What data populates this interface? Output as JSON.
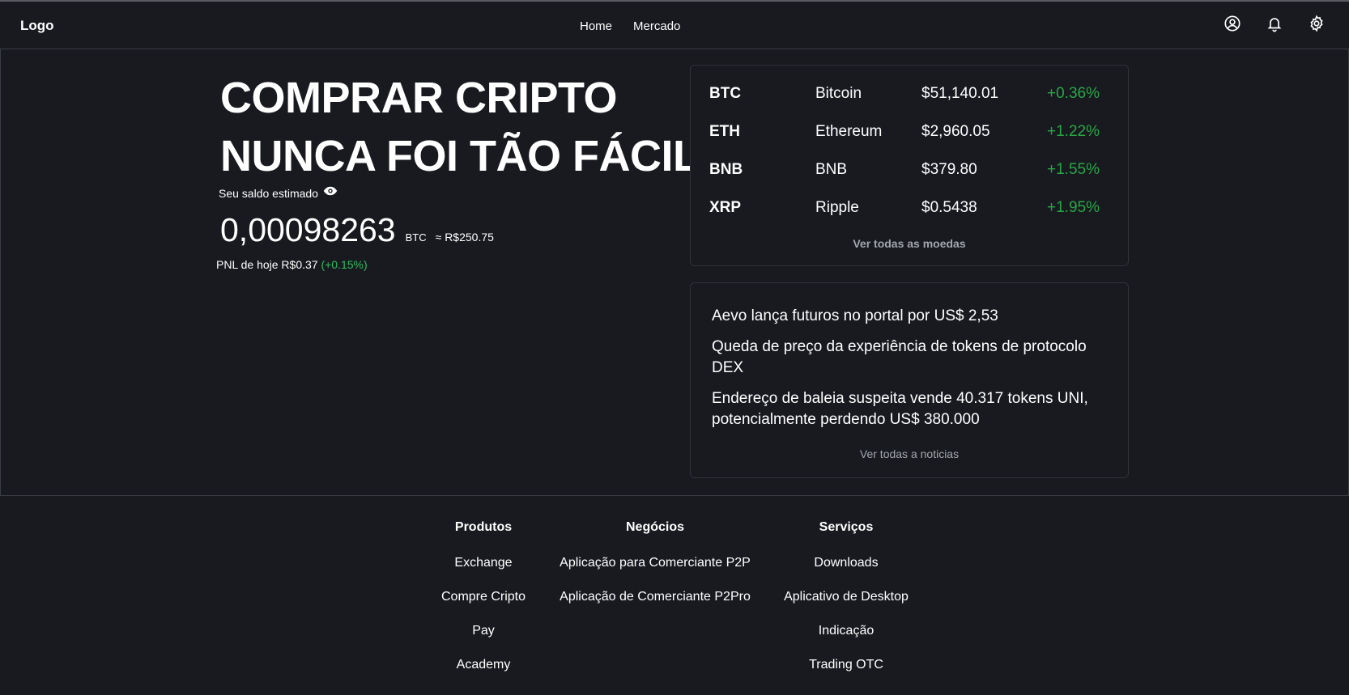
{
  "header": {
    "logo": "Logo",
    "nav": [
      "Home",
      "Mercado"
    ],
    "icons": [
      "user-icon",
      "bell-icon",
      "settings-icon"
    ]
  },
  "hero": {
    "title_line1": "COMPRAR CRIPTO",
    "title_line2": "NUNCA FOI TÃO FÁCIL",
    "balance_label": "Seu saldo estimado",
    "balance_value": "0,00098263",
    "balance_unit": "BTC",
    "balance_fiat": "≈ R$250.75",
    "pnl_label": "PNL de hoje R$0.37",
    "pnl_change": "(+0.15%)"
  },
  "coins": {
    "items": [
      {
        "symbol": "BTC",
        "name": "Bitcoin",
        "price": "$51,140.01",
        "change": "+0.36%"
      },
      {
        "symbol": "ETH",
        "name": "Ethereum",
        "price": "$2,960.05",
        "change": "+1.22%"
      },
      {
        "symbol": "BNB",
        "name": "BNB",
        "price": "$379.80",
        "change": "+1.55%"
      },
      {
        "symbol": "XRP",
        "name": "Ripple",
        "price": "$0.5438",
        "change": "+1.95%"
      }
    ],
    "more_label": "Ver todas as moedas"
  },
  "news": {
    "items": [
      "Aevo lança futuros no portal por US$ 2,53",
      "Queda de preço da experiência de tokens de protocolo DEX",
      "Endereço de baleia suspeita vende 40.317 tokens UNI, potencialmente perdendo US$ 380.000"
    ],
    "more_label": "Ver todas a noticias"
  },
  "footer": {
    "produtos": {
      "title": "Produtos",
      "links": [
        "Exchange",
        "Compre Cripto",
        "Pay",
        "Academy"
      ]
    },
    "negocios": {
      "title": "Negócios",
      "links": [
        "Aplicação para Comerciante P2P",
        "Aplicação de Comerciante P2Pro"
      ]
    },
    "servicos": {
      "title": "Serviços",
      "links": [
        "Downloads",
        "Aplicativo de Desktop",
        "Indicação",
        "Trading OTC"
      ]
    }
  },
  "colors": {
    "background": "#181a20",
    "positive": "#28a745",
    "text": "#ffffff",
    "muted": "#a3a6ad"
  }
}
